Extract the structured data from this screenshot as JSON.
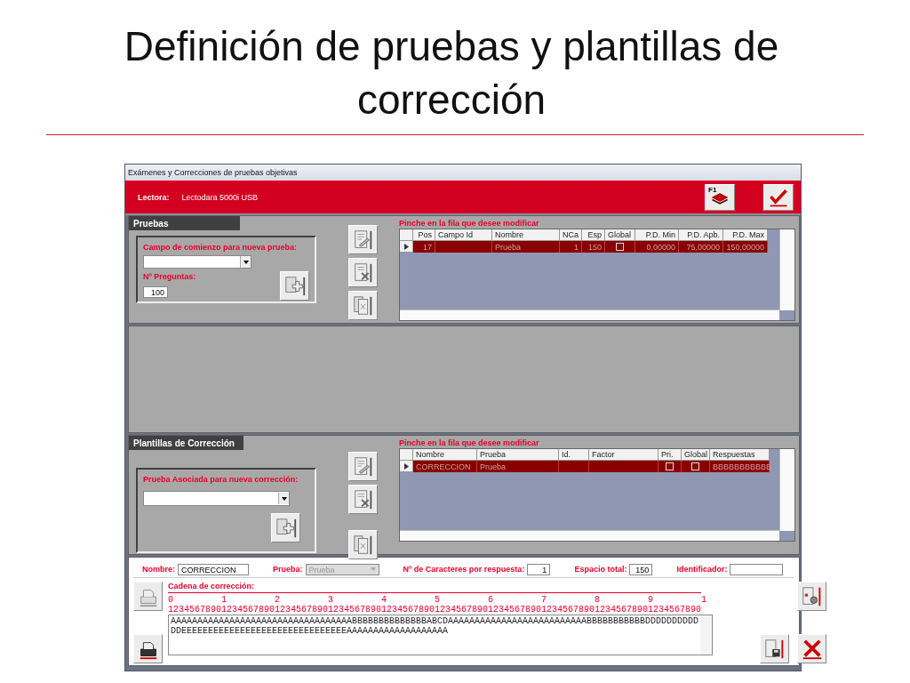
{
  "slide": {
    "title": "Definición de pruebas y plantillas de corrección"
  },
  "window": {
    "title": "Exámenes y Correcciones de pruebas objetivas"
  },
  "header": {
    "reader_label": "Lectora:",
    "reader_value": "Lectodara 5000i USB",
    "help_key": "F1"
  },
  "pruebas": {
    "title": "Pruebas",
    "start_label": "Campo de comienzo para nueva prueba:",
    "questions_label": "Nº Preguntas:",
    "questions_value": "100",
    "grid": {
      "hint": "Pinche en la fila que desee modificar",
      "columns": [
        "Pos",
        "Campo Id",
        "Nombre",
        "NCa",
        "Esp",
        "Global",
        "P.D. Min",
        "P.D. Apb.",
        "P.D. Max"
      ],
      "rows": [
        {
          "selected": true,
          "cells": [
            {
              "kind": "text",
              "text": "17"
            },
            {
              "kind": "empty"
            },
            {
              "kind": "text",
              "text": "Prueba"
            },
            {
              "kind": "text",
              "text": "1"
            },
            {
              "kind": "text",
              "text": "150"
            },
            {
              "kind": "check",
              "checked": false
            },
            {
              "kind": "text",
              "text": "0,00000"
            },
            {
              "kind": "text",
              "text": "75,00000"
            },
            {
              "kind": "text",
              "text": "150,00000"
            }
          ]
        }
      ]
    }
  },
  "plantillas": {
    "title": "Plantillas de Corrección",
    "assoc_label": "Prueba Asociada para nueva corrección:",
    "grid": {
      "hint": "Pinche en la fila que desee modificar",
      "columns": [
        "Nombre",
        "Prueba",
        "Id.",
        "Factor",
        "Pri.",
        "Global",
        "Respuestas"
      ],
      "rows": [
        {
          "selected": true,
          "cells": [
            {
              "kind": "text",
              "text": "CORRECCION"
            },
            {
              "kind": "text",
              "text": "Prueba"
            },
            {
              "kind": "empty"
            },
            {
              "kind": "empty"
            },
            {
              "kind": "check",
              "checked": false
            },
            {
              "kind": "check",
              "checked": false
            },
            {
              "kind": "text",
              "text": "BBBBBBBBBBB"
            }
          ]
        }
      ]
    }
  },
  "detail": {
    "fields": [
      {
        "label": "Nombre:",
        "value": "CORRECCION",
        "kind": "text",
        "disabled": false
      },
      {
        "label": "Prueba:",
        "value": "Prueba",
        "kind": "select",
        "disabled": true
      },
      {
        "label": "Nº de Caracteres por respuesta:",
        "value": "1",
        "kind": "number",
        "disabled": false
      },
      {
        "label": "Espacio total:",
        "value": "150",
        "kind": "number",
        "disabled": false
      },
      {
        "label": "Identificador:",
        "kind": "text",
        "disabled": false
      }
    ],
    "string_label": "Cadena de corrección:",
    "ruler_tens": [
      "0",
      "1",
      "2",
      "3",
      "4",
      "5",
      "6",
      "7",
      "8",
      "9",
      "1"
    ],
    "ruler_units": "1234567890123456789012345678901234567890123456789012345678901234567890123456789012345678901234567890",
    "string_lines": [
      "AAAAAAAAAAAAAAAAAAAAAAAAAAAAAAAAAABBBBBBBBBBBBBBABCDAAAAAAAAAAAAAAAAAAAAAAAAAABBBBBBBBBBBDDDDDDDDDD",
      "DDEEEEEEEEEEEEEEEEEEEEEEEEEEEEEEEAAAAAAAAAAAAAAAAAAA"
    ]
  }
}
